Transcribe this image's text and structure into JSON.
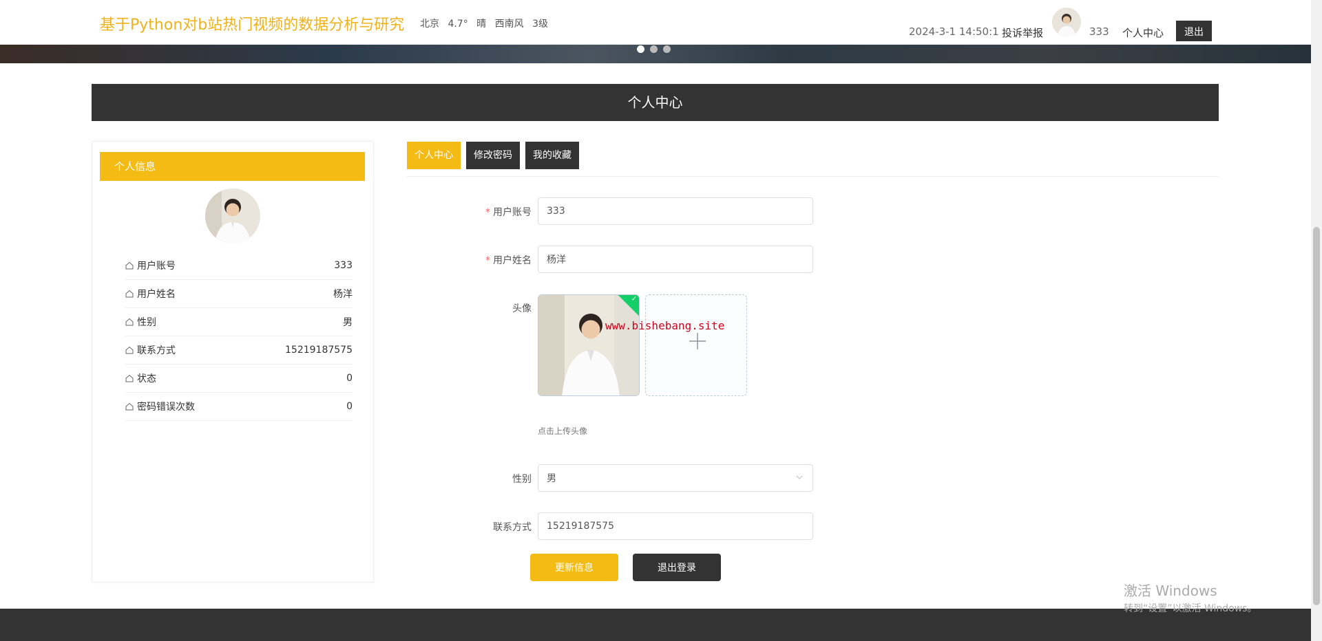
{
  "header": {
    "site_title": "基于Python对b站热门视频的数据分析与研究",
    "weather": {
      "city": "北京",
      "temperature": "4.7°",
      "condition": "晴",
      "wind_direction": "西南风",
      "wind_level": "3级"
    },
    "datetime": "2024-3-1 14:50:1",
    "complaint_link": "投诉举报",
    "username": "333",
    "user_center_link": "个人中心",
    "logout_button": "退出"
  },
  "page_title": "个人中心",
  "left_panel": {
    "header": "个人信息",
    "rows": [
      {
        "label": "用户账号",
        "value": "333"
      },
      {
        "label": "用户姓名",
        "value": "杨洋"
      },
      {
        "label": "性别",
        "value": "男"
      },
      {
        "label": "联系方式",
        "value": "15219187575"
      },
      {
        "label": "状态",
        "value": "0"
      },
      {
        "label": "密码错误次数",
        "value": "0"
      }
    ]
  },
  "tabs": [
    {
      "label": "个人中心",
      "active": true
    },
    {
      "label": "修改密码",
      "active": false
    },
    {
      "label": "我的收藏",
      "active": false
    }
  ],
  "form": {
    "account_label": "用户账号",
    "account_value": "333",
    "name_label": "用户姓名",
    "name_value": "杨洋",
    "avatar_label": "头像",
    "upload_hint": "点击上传头像",
    "watermark": "www.bishebang.site",
    "gender_label": "性别",
    "gender_value": "男",
    "phone_label": "联系方式",
    "phone_value": "15219187575",
    "update_button": "更新信息",
    "logout_button": "退出登录"
  },
  "os_overlay": {
    "line1": "激活 Windows",
    "line2": "转到“设置”以激活 Windows。"
  },
  "colors": {
    "accent": "#f4bb14",
    "dark": "#333333",
    "success": "#13ce66",
    "required": "#f56c6c"
  },
  "icons": [
    "home-icon",
    "check-icon",
    "plus-icon",
    "chevron-down-icon"
  ]
}
